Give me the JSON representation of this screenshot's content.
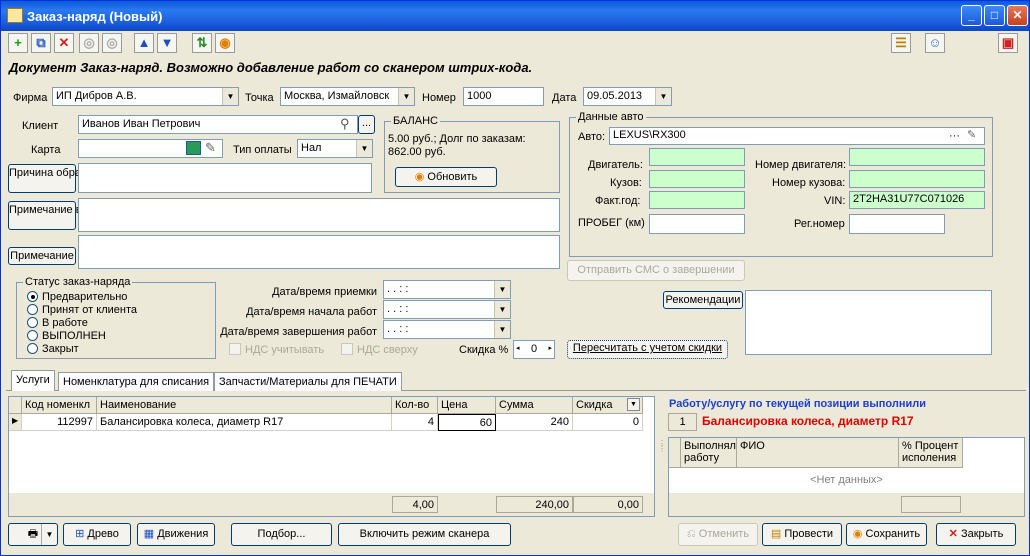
{
  "window": {
    "title": "Заказ-наряд (Новый)"
  },
  "heading": "Документ Заказ-наряд. Возможно добавление работ со сканером штрих-кода.",
  "firma": {
    "label": "Фирма",
    "value": "ИП Дибров А.В."
  },
  "tochka": {
    "label": "Точка",
    "value": "Москва, Измайловск"
  },
  "nomer": {
    "label": "Номер",
    "value": "1000"
  },
  "data": {
    "label": "Дата",
    "value": "09.05.2013"
  },
  "client": {
    "label": "Клиент",
    "value": "Иванов Иван Петрович"
  },
  "karta": {
    "label": "Карта",
    "value": ""
  },
  "tip_oplaty": {
    "label": "Тип оплаты",
    "value": "Нал"
  },
  "prichina": {
    "label": "Причина обращения"
  },
  "prim_vn": {
    "label": "Примечание внутренние"
  },
  "prim": {
    "label": "Примечание"
  },
  "balance": {
    "caption": "БАЛАНС",
    "text": "5.00 руб.; Долг по заказам: 862.00 руб.",
    "refresh": "Обновить"
  },
  "auto": {
    "caption": "Данные авто",
    "auto_label": "Авто:",
    "auto_value": "LEXUS\\RX300",
    "dvig": "Двигатель:",
    "kuzov": "Кузов:",
    "fakt": "Факт.год:",
    "probeg": "ПРОБЕГ (км)",
    "nomer_dvig": "Номер двигателя:",
    "nomer_kuz": "Номер кузова:",
    "vin_label": "VIN:",
    "vin_value": "2T2HA31U77C071026",
    "reg": "Рег.номер"
  },
  "sms": "Отправить СМС о завершении",
  "status": {
    "caption": "Статус заказ-наряда",
    "items": [
      "Предварительно",
      "Принят от клиента",
      "В работе",
      "ВЫПОЛНЕН",
      "Закрыт"
    ],
    "selected": 0
  },
  "dates": {
    "priem": "Дата/время приемки",
    "nachalo": "Дата/время начала работ",
    "zavers": "Дата/время завершения работ",
    "mask": " .  .        :  :"
  },
  "nds1": "НДС учитывать",
  "nds2": "НДС сверху",
  "skidka": {
    "label": "Скидка %",
    "value": "0"
  },
  "recalc": "Пересчитать с учетом скидки",
  "recom": "Рекомендации",
  "tabs": [
    "Услуги",
    "Номенклатура для списания",
    "Запчасти/Материалы для ПЕЧАТИ"
  ],
  "table": {
    "headers": [
      "Код номенкл",
      "Наименование",
      "Кол-во",
      "Цена",
      "Сумма",
      "Скидка"
    ],
    "rows": [
      {
        "kod": "112997",
        "name": "Балансировка колеса, диаметр R17",
        "qty": "4",
        "price": "60",
        "sum": "240",
        "disc": "0"
      }
    ],
    "totals": {
      "qty": "4,00",
      "sum": "240,00",
      "disc": "0,00"
    }
  },
  "workers": {
    "title": "Работу/услугу по текущей позиции выполнили",
    "num": "1",
    "item": "Балансировка колеса, диаметр R17",
    "h1": "Выполнял работу",
    "h2": "ФИО",
    "h3": "% Процент исполения",
    "empty": "<Нет данных>"
  },
  "buttons": {
    "drevo": "Древо",
    "dvizh": "Движения",
    "podbor": "Подбор...",
    "scanner": "Включить режим сканера",
    "otmenit": "Отменить",
    "provesti": "Провести",
    "sohranit": "Сохранить",
    "zakryt": "Закрыть"
  },
  "colors": {
    "green": "#ccffcc",
    "blue_title": "#1c3fcf",
    "red_item": "#e00000"
  }
}
